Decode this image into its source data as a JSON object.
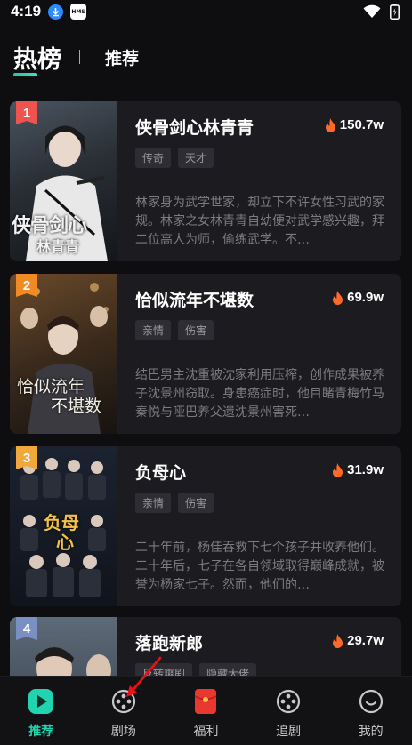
{
  "status": {
    "time": "4:19",
    "hms": "HMS"
  },
  "header": {
    "active_tab": "热榜",
    "other_tab": "推荐"
  },
  "items": [
    {
      "rank": "1",
      "rank_color": "#ef5350",
      "title": "侠骨剑心林青青",
      "heat": "150.7w",
      "tags": [
        "传奇",
        "天才"
      ],
      "desc": "林家身为武学世家，却立下不许女性习武的家规。林家之女林青青自幼便对武学感兴趣，拜二位高人为师，偷练武学。不…",
      "poster_text": [
        "侠骨剑心",
        "林青青"
      ]
    },
    {
      "rank": "2",
      "rank_color": "#f08a24",
      "title": "恰似流年不堪数",
      "heat": "69.9w",
      "tags": [
        "亲情",
        "伤害"
      ],
      "desc": "结巴男主沈重被沈家利用压榨，创作成果被养子沈景州窃取。身患癌症时，他目睹青梅竹马秦悦与哑巴养父遗沈景州害死…",
      "poster_text": [
        "恰似流年",
        "不堪数"
      ]
    },
    {
      "rank": "3",
      "rank_color": "#f0a83a",
      "title": "负母心",
      "heat": "31.9w",
      "tags": [
        "亲情",
        "伤害"
      ],
      "desc": "二十年前，杨佳吞救下七个孩子并收养他们。二十年后，七子在各自领域取得巅峰成就，被誉为杨家七子。然而，他们的…",
      "poster_text": [
        "负母",
        "心"
      ]
    },
    {
      "rank": "4",
      "rank_color": "#7a8fc4",
      "title": "落跑新郎",
      "heat": "29.7w",
      "tags": [
        "反转爽剧",
        "隐藏大佬"
      ],
      "desc": "",
      "poster_text": [
        "",
        ""
      ]
    }
  ],
  "nav": [
    {
      "label": "推荐",
      "icon": "play-icon",
      "active": true
    },
    {
      "label": "剧场",
      "icon": "film-reel-icon",
      "active": false
    },
    {
      "label": "福利",
      "icon": "red-envelope-icon",
      "active": false
    },
    {
      "label": "追剧",
      "icon": "film-reel-icon",
      "active": false
    },
    {
      "label": "我的",
      "icon": "smile-icon",
      "active": false
    }
  ],
  "colors": {
    "accent": "#22d3b0",
    "heat": "#ff6a2b"
  }
}
